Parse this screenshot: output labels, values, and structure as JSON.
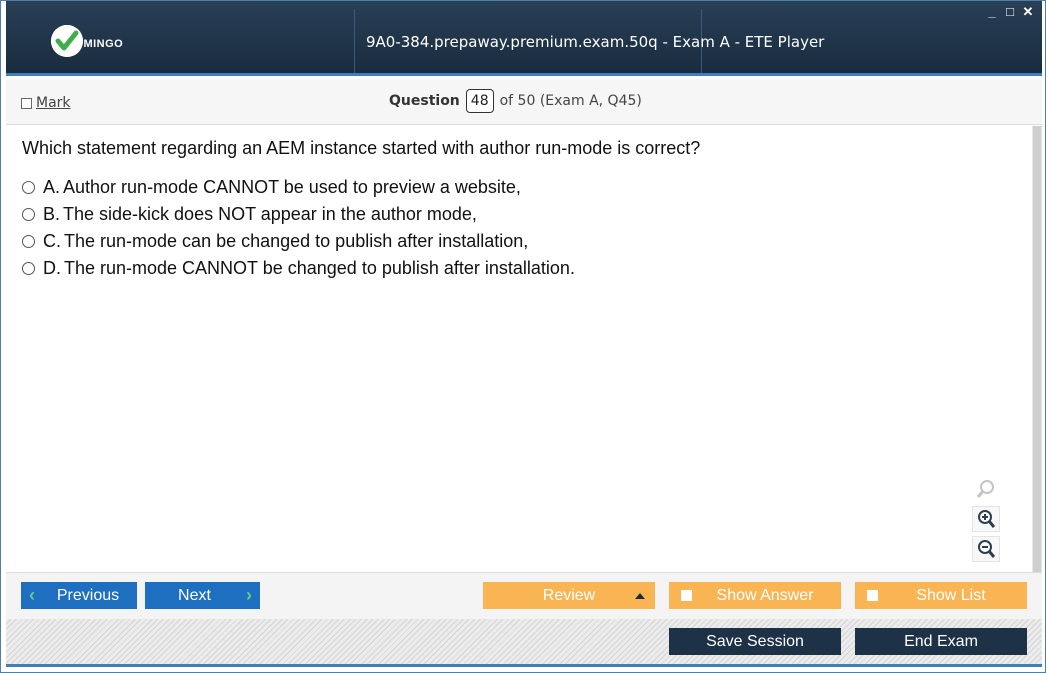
{
  "window": {
    "logo_text": "UMINGO",
    "title": "9A0-384.prepaway.premium.exam.50q - Exam A - ETE Player",
    "controls": {
      "minimize": "_",
      "maximize": "□",
      "close": "✕"
    }
  },
  "question_bar": {
    "mark_label": "Mark",
    "question_label": "Question",
    "question_number": "48",
    "question_of": "of 50 (Exam A, Q45)"
  },
  "question": {
    "text": "Which statement regarding an AEM instance started with author run-mode is correct?",
    "options": [
      {
        "letter": "A.",
        "text": "Author run-mode CANNOT be used to preview a website,"
      },
      {
        "letter": "B.",
        "text": "The side-kick does NOT appear in the author mode,"
      },
      {
        "letter": "C.",
        "text": "The run-mode can be changed to publish after installation,"
      },
      {
        "letter": "D.",
        "text": "The run-mode CANNOT be changed to publish after installation."
      }
    ]
  },
  "zoom": {
    "icons": [
      "search-icon",
      "zoom-in-icon",
      "zoom-out-icon"
    ]
  },
  "nav": {
    "previous": "Previous",
    "next": "Next",
    "review": "Review",
    "show_answer": "Show Answer",
    "show_list": "Show List",
    "save_session": "Save Session",
    "end_exam": "End Exam"
  },
  "colors": {
    "titlebar": "#1f3347",
    "accent_blue": "#1f6fc0",
    "accent_orange": "#f9b554",
    "dark_button": "#1d3147",
    "chevron_green": "#5fd08a"
  }
}
